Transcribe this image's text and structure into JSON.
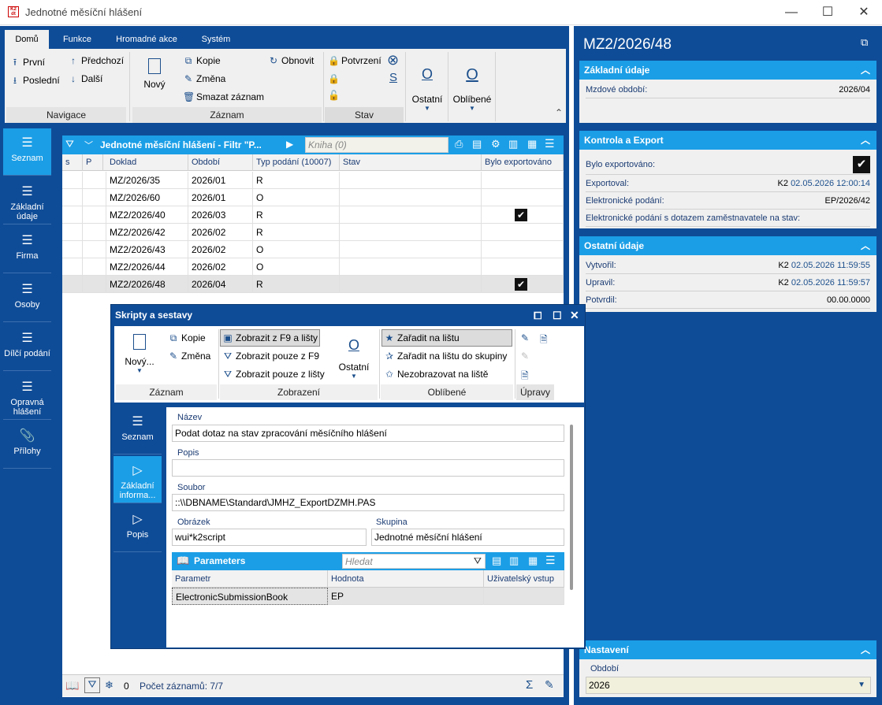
{
  "window": {
    "title": "Jednotné měsíční hlášení",
    "minimize": "—",
    "maximize": "☐",
    "close": "✕"
  },
  "ribbon": {
    "tabs": [
      "Domů",
      "Funkce",
      "Hromadné akce",
      "Systém"
    ],
    "nav": {
      "first": "První",
      "last": "Poslední",
      "prev": "Předchozí",
      "next": "Další",
      "group": "Navigace"
    },
    "record": {
      "new": "Nový",
      "copy": "Kopie",
      "change": "Změna",
      "delete": "Smazat záznam",
      "refresh": "Obnovit",
      "group": "Záznam"
    },
    "state": {
      "confirm": "Potvrzení",
      "s": "S",
      "group": "Stav"
    },
    "other": {
      "label": "Ostatní",
      "favorite": "Oblíbené",
      "o": "O"
    }
  },
  "leftnav": [
    "Seznam",
    "Základní údaje",
    "Firma",
    "Osoby",
    "Dílčí podání",
    "Opravná hlášení",
    "Přílohy"
  ],
  "grid": {
    "title": "Jednotné měsíční hlášení - Filtr \"P...",
    "search_placeholder": "Kniha (0)",
    "columns": [
      "s",
      "P",
      "Doklad",
      "Období",
      "Typ podání (10007)",
      "Stav",
      "Bylo exportováno"
    ],
    "rows": [
      {
        "doklad": "MZ/2026/35",
        "obdobi": "2026/01",
        "typ": "R",
        "exported": false
      },
      {
        "doklad": "MZ/2026/60",
        "obdobi": "2026/01",
        "typ": "O",
        "exported": false
      },
      {
        "doklad": "MZ2/2026/40",
        "obdobi": "2026/03",
        "typ": "R",
        "exported": true
      },
      {
        "doklad": "MZ2/2026/42",
        "obdobi": "2026/02",
        "typ": "R",
        "exported": false
      },
      {
        "doklad": "MZ2/2026/43",
        "obdobi": "2026/02",
        "typ": "O",
        "exported": false
      },
      {
        "doklad": "MZ2/2026/44",
        "obdobi": "2026/02",
        "typ": "O",
        "exported": false
      },
      {
        "doklad": "MZ2/2026/48",
        "obdobi": "2026/04",
        "typ": "R",
        "exported": true
      }
    ],
    "status_count": "0",
    "status_records": "Počet záznamů: 7/7"
  },
  "right": {
    "title": "MZ2/2026/48",
    "basic": {
      "head": "Základní údaje",
      "label": "Mzdové období:",
      "value": "2026/04"
    },
    "export": {
      "head": "Kontrola a Export",
      "exported_label": "Bylo exportováno:",
      "exported_by_label": "Exportoval:",
      "exported_by_user": "K2",
      "exported_by_date": "02.05.2026 12:00:14",
      "esub_label": "Elektronické podání:",
      "esub_value": "EP/2026/42",
      "esub_query_label": "Elektronické podání s dotazem zaměstnavatele na stav:"
    },
    "other": {
      "head": "Ostatní údaje",
      "created_label": "Vytvořil:",
      "created_user": "K2",
      "created_date": "02.05.2026 11:59:55",
      "modified_label": "Upravil:",
      "modified_user": "K2",
      "modified_date": "02.05.2026 11:59:57",
      "confirmed_label": "Potvrdil:",
      "confirmed_date": "00.00.0000"
    },
    "settings": {
      "head": "Nastavení",
      "period_label": "Období",
      "period_value": "2026"
    }
  },
  "dialog": {
    "title": "Skripty a sestavy",
    "ribbon": {
      "new": "Nový...",
      "copy": "Kopie",
      "change": "Změna",
      "group_record": "Záznam",
      "show_f9_bar": "Zobrazit z F9 a lišty",
      "show_f9": "Zobrazit pouze z F9",
      "show_bar": "Zobrazit pouze z lišty",
      "other": "Ostatní",
      "o": "O",
      "group_display": "Zobrazení",
      "add_bar": "Zařadit na lištu",
      "add_bar_group": "Zařadit na lištu do skupiny",
      "no_show_bar": "Nezobrazovat na liště",
      "group_fav": "Oblíbené",
      "group_edit": "Úpravy"
    },
    "nav": [
      "Seznam",
      "Základní informa...",
      "Popis"
    ],
    "fields": {
      "name_label": "Název",
      "name_value": "Podat dotaz na stav zpracování měsíčního hlášení",
      "desc_label": "Popis",
      "desc_value": "",
      "file_label": "Soubor",
      "file_value": "::\\\\DBNAME\\Standard\\JMHZ_ExportDZMH.PAS",
      "image_label": "Obrázek",
      "image_value": "wui*k2script",
      "group_label": "Skupina",
      "group_value": "Jednotné měsíční hlášení"
    },
    "params": {
      "title": "Parameters",
      "search_placeholder": "Hledat",
      "columns": [
        "Parametr",
        "Hodnota",
        "Uživatelský vstup"
      ],
      "rows": [
        {
          "param": "ElectronicSubmissionBook",
          "value": "EP",
          "user": ""
        }
      ]
    }
  }
}
